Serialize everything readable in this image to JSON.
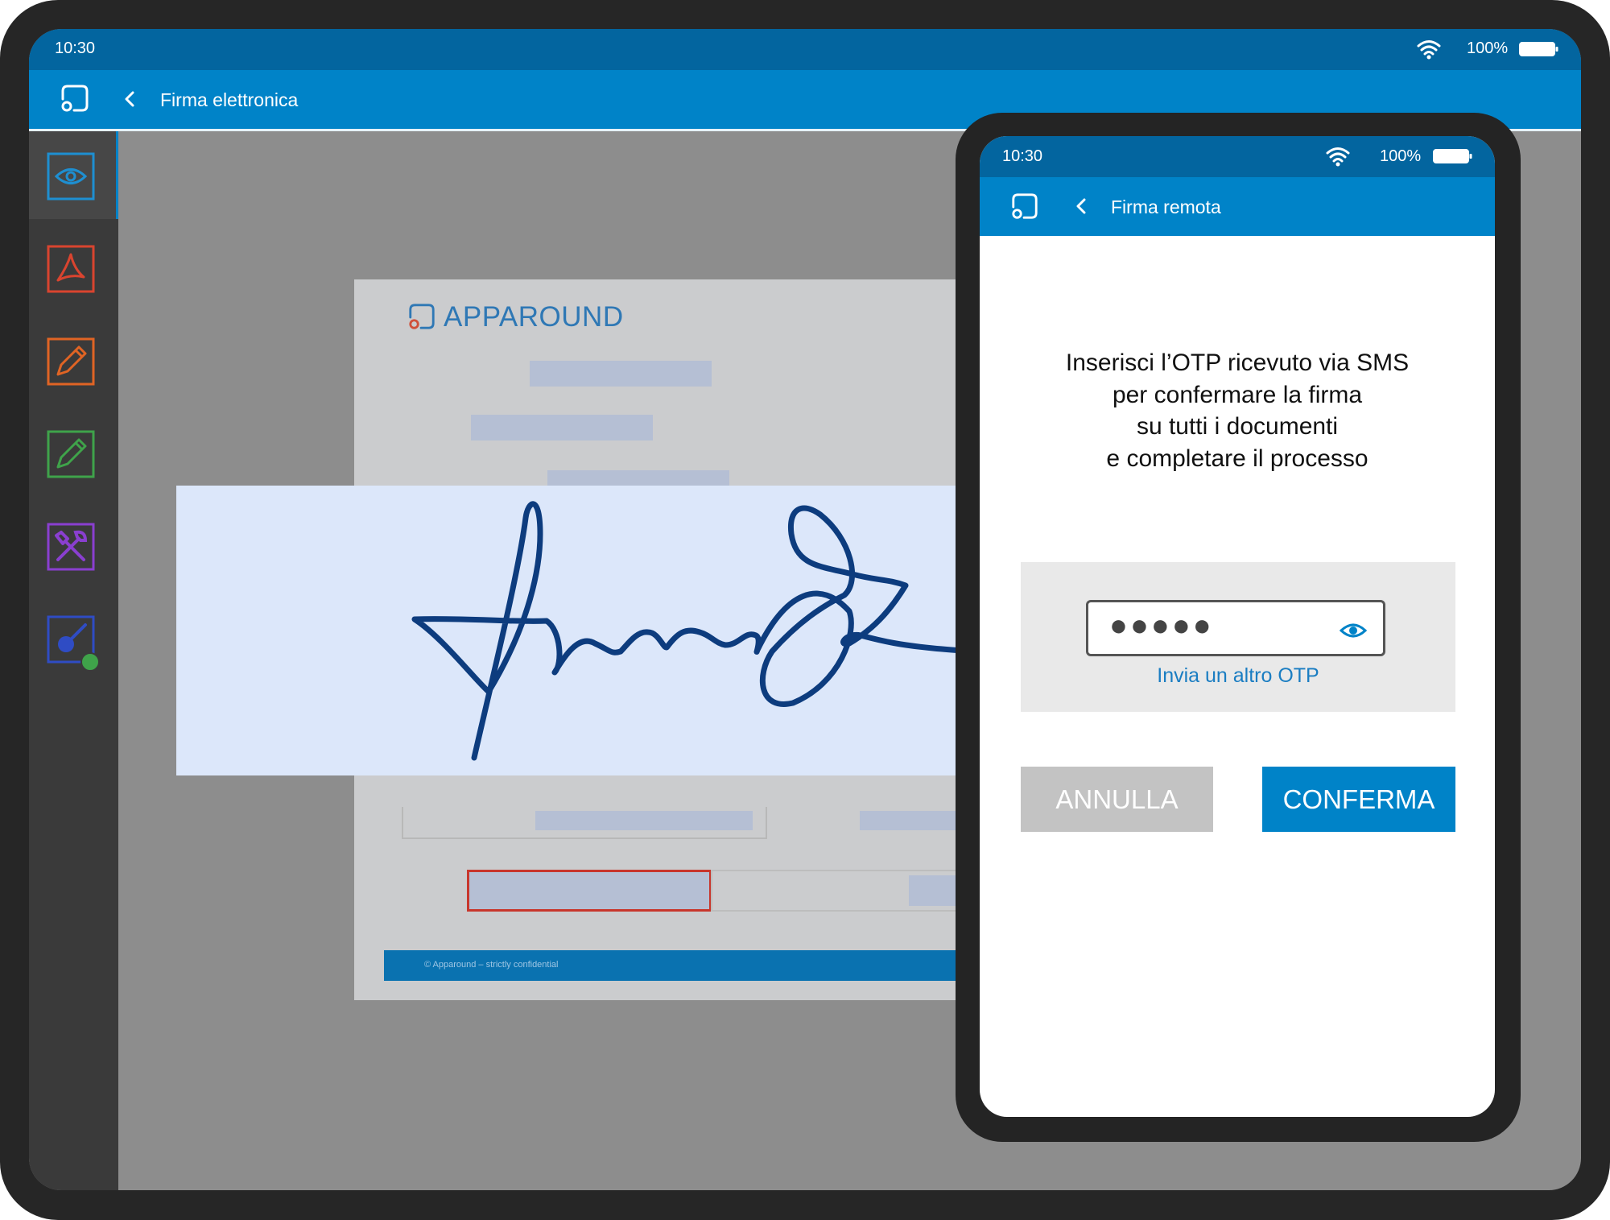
{
  "tablet": {
    "status_bar": {
      "time": "10:30",
      "battery": "100%"
    },
    "app_bar": {
      "title": "Firma elettronica"
    },
    "sidebar": {
      "items": [
        {
          "icon": "eye-icon",
          "color": "#1e8fd1",
          "active": true
        },
        {
          "icon": "pdf-icon",
          "color": "#d9442f"
        },
        {
          "icon": "pencil-icon",
          "color": "#e06424"
        },
        {
          "icon": "pencil-icon",
          "color": "#3fa34a"
        },
        {
          "icon": "tools-icon",
          "color": "#8a3fd0"
        },
        {
          "icon": "signature-icon",
          "color": "#2f4cc4"
        }
      ]
    },
    "document": {
      "brand": "APPAROUND",
      "footer": "© Apparound – strictly confidential"
    }
  },
  "phone": {
    "status_bar": {
      "time": "10:30",
      "battery": "100%"
    },
    "app_bar": {
      "title": "Firma remota"
    },
    "instructions": [
      "Inserisci l’OTP ricevuto via SMS",
      "per confermare la firma",
      "su tutti i documenti",
      "e completare il processo"
    ],
    "otp": {
      "masked_value": "●●●●●",
      "resend_label": "Invia un altro OTP"
    },
    "buttons": {
      "cancel": "ANNULLA",
      "confirm": "CONFERMA"
    }
  },
  "colors": {
    "app_bar": "#0083c8",
    "status_bar": "#03659f",
    "signature_ink": "#0d3c7e",
    "signature_pad": "#dce7fa"
  }
}
